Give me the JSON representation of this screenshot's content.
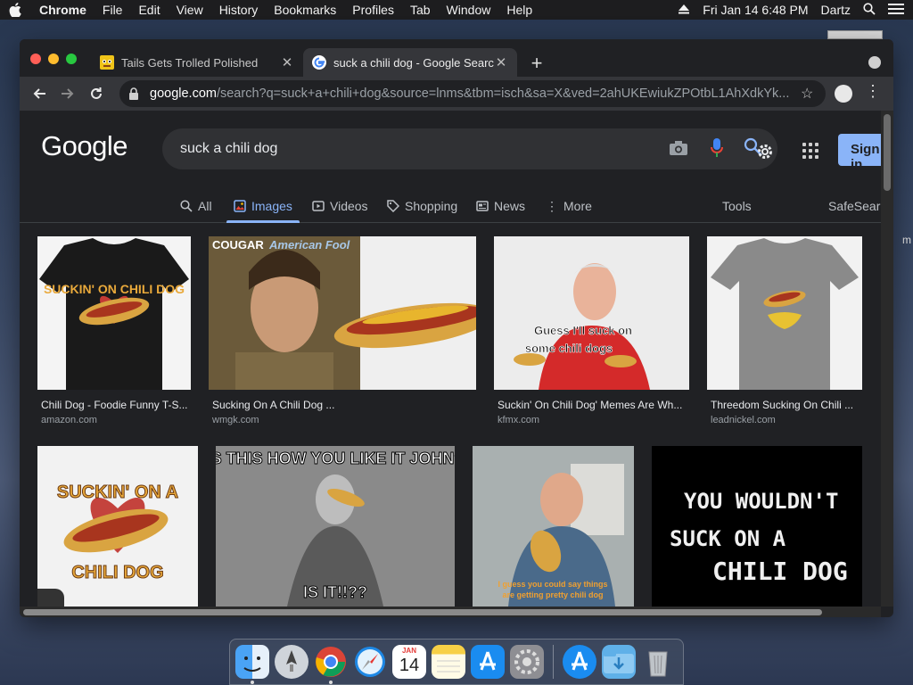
{
  "menubar": {
    "app": "Chrome",
    "items": [
      "File",
      "Edit",
      "View",
      "History",
      "Bookmarks",
      "Profiles",
      "Tab",
      "Window",
      "Help"
    ],
    "datetime": "Fri Jan 14  6:48 PM",
    "user": "Dartz"
  },
  "desktop": {
    "edge_text": "m"
  },
  "browser": {
    "tabs": [
      {
        "title": "Tails Gets Trolled Polished",
        "active": false
      },
      {
        "title": "suck a chili dog - Google Search",
        "active": true
      }
    ],
    "new_tab": "+",
    "url_host": "google.com",
    "url_path": "/search?q=suck+a+chili+dog&source=lnms&tbm=isch&sa=X&ved=2ahUKEwiukZPOtbL1AhXdkYk..."
  },
  "google": {
    "logo": "Google",
    "query": "suck a chili dog",
    "sign_in": "Sign in",
    "tabs": [
      {
        "label": "All",
        "icon": "search-icon"
      },
      {
        "label": "Images",
        "icon": "images-icon",
        "active": true
      },
      {
        "label": "Videos",
        "icon": "video-icon"
      },
      {
        "label": "Shopping",
        "icon": "tag-icon"
      },
      {
        "label": "News",
        "icon": "news-icon"
      },
      {
        "label": "More",
        "icon": "more-vert-icon"
      }
    ],
    "tools": "Tools",
    "safesearch": "SafeSearch",
    "results": [
      {
        "title": "Chili Dog - Foodie Funny T-S...",
        "source": "amazon.com",
        "img_text": "SUCKIN' ON CHILI DOG"
      },
      {
        "title": "Sucking On A Chili Dog ...",
        "source": "wmgk.com",
        "img_text": "COUGAR American Fool"
      },
      {
        "title": "Suckin' On Chili Dog' Memes Are Wh...",
        "source": "kfmx.com",
        "img_text": "Guess I'll suck on some chili dogs"
      },
      {
        "title": "Threedom Sucking On Chili ...",
        "source": "leadnickel.com",
        "img_text": ""
      },
      {
        "title": "",
        "source": "",
        "img_text": "SUCKIN' ON A CHILI DOG"
      },
      {
        "title": "",
        "source": "",
        "img_text_top": "IS THIS HOW YOU LIKE IT JOHN?",
        "img_text_bottom": "IS IT!!??"
      },
      {
        "title": "",
        "source": "",
        "img_text": "I guess you could say things are getting pretty chili dog"
      },
      {
        "title": "",
        "source": "",
        "img_text_1": "YOU WOULDN'T",
        "img_text_2": "SUCK ON A",
        "img_text_3": "CHILI DOG"
      }
    ]
  },
  "dock": {
    "apps": [
      "finder-icon",
      "launchpad-icon",
      "chrome-icon",
      "safari-icon",
      "calendar-icon",
      "notes-icon",
      "app-store-icon",
      "system-preferences-icon",
      "app-store-icon",
      "downloads-folder-icon",
      "trash-icon"
    ],
    "calendar_month": "JAN",
    "calendar_day": "14"
  }
}
